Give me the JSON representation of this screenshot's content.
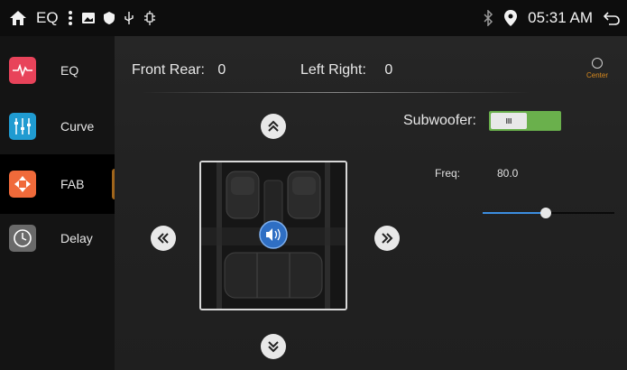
{
  "statusbar": {
    "title": "EQ",
    "time": "05:31 AM"
  },
  "sidebar": {
    "items": [
      {
        "label": "EQ",
        "icon": "eq-wave-icon",
        "color": "#e8435a"
      },
      {
        "label": "Curve",
        "icon": "curve-sliders-icon",
        "color": "#1f9bd1"
      },
      {
        "label": "FAB",
        "icon": "fader-balance-icon",
        "color": "#f06a3a",
        "active": true
      },
      {
        "label": "Delay",
        "icon": "clock-icon",
        "color": "#6a6a6a"
      }
    ]
  },
  "main": {
    "front_rear_label": "Front Rear:",
    "front_rear_value": "0",
    "left_right_label": "Left Right:",
    "left_right_value": "0",
    "center_label": "Center",
    "subwoofer_label": "Subwoofer:",
    "subwoofer_toggle_text": "III",
    "freq_label": "Freq:",
    "freq_value": "80.0",
    "freq_slider_fraction": 0.48
  },
  "colors": {
    "accent_orange": "#d98a1e",
    "toggle_green": "#6ab04c",
    "slider_blue": "#3c8de0"
  }
}
